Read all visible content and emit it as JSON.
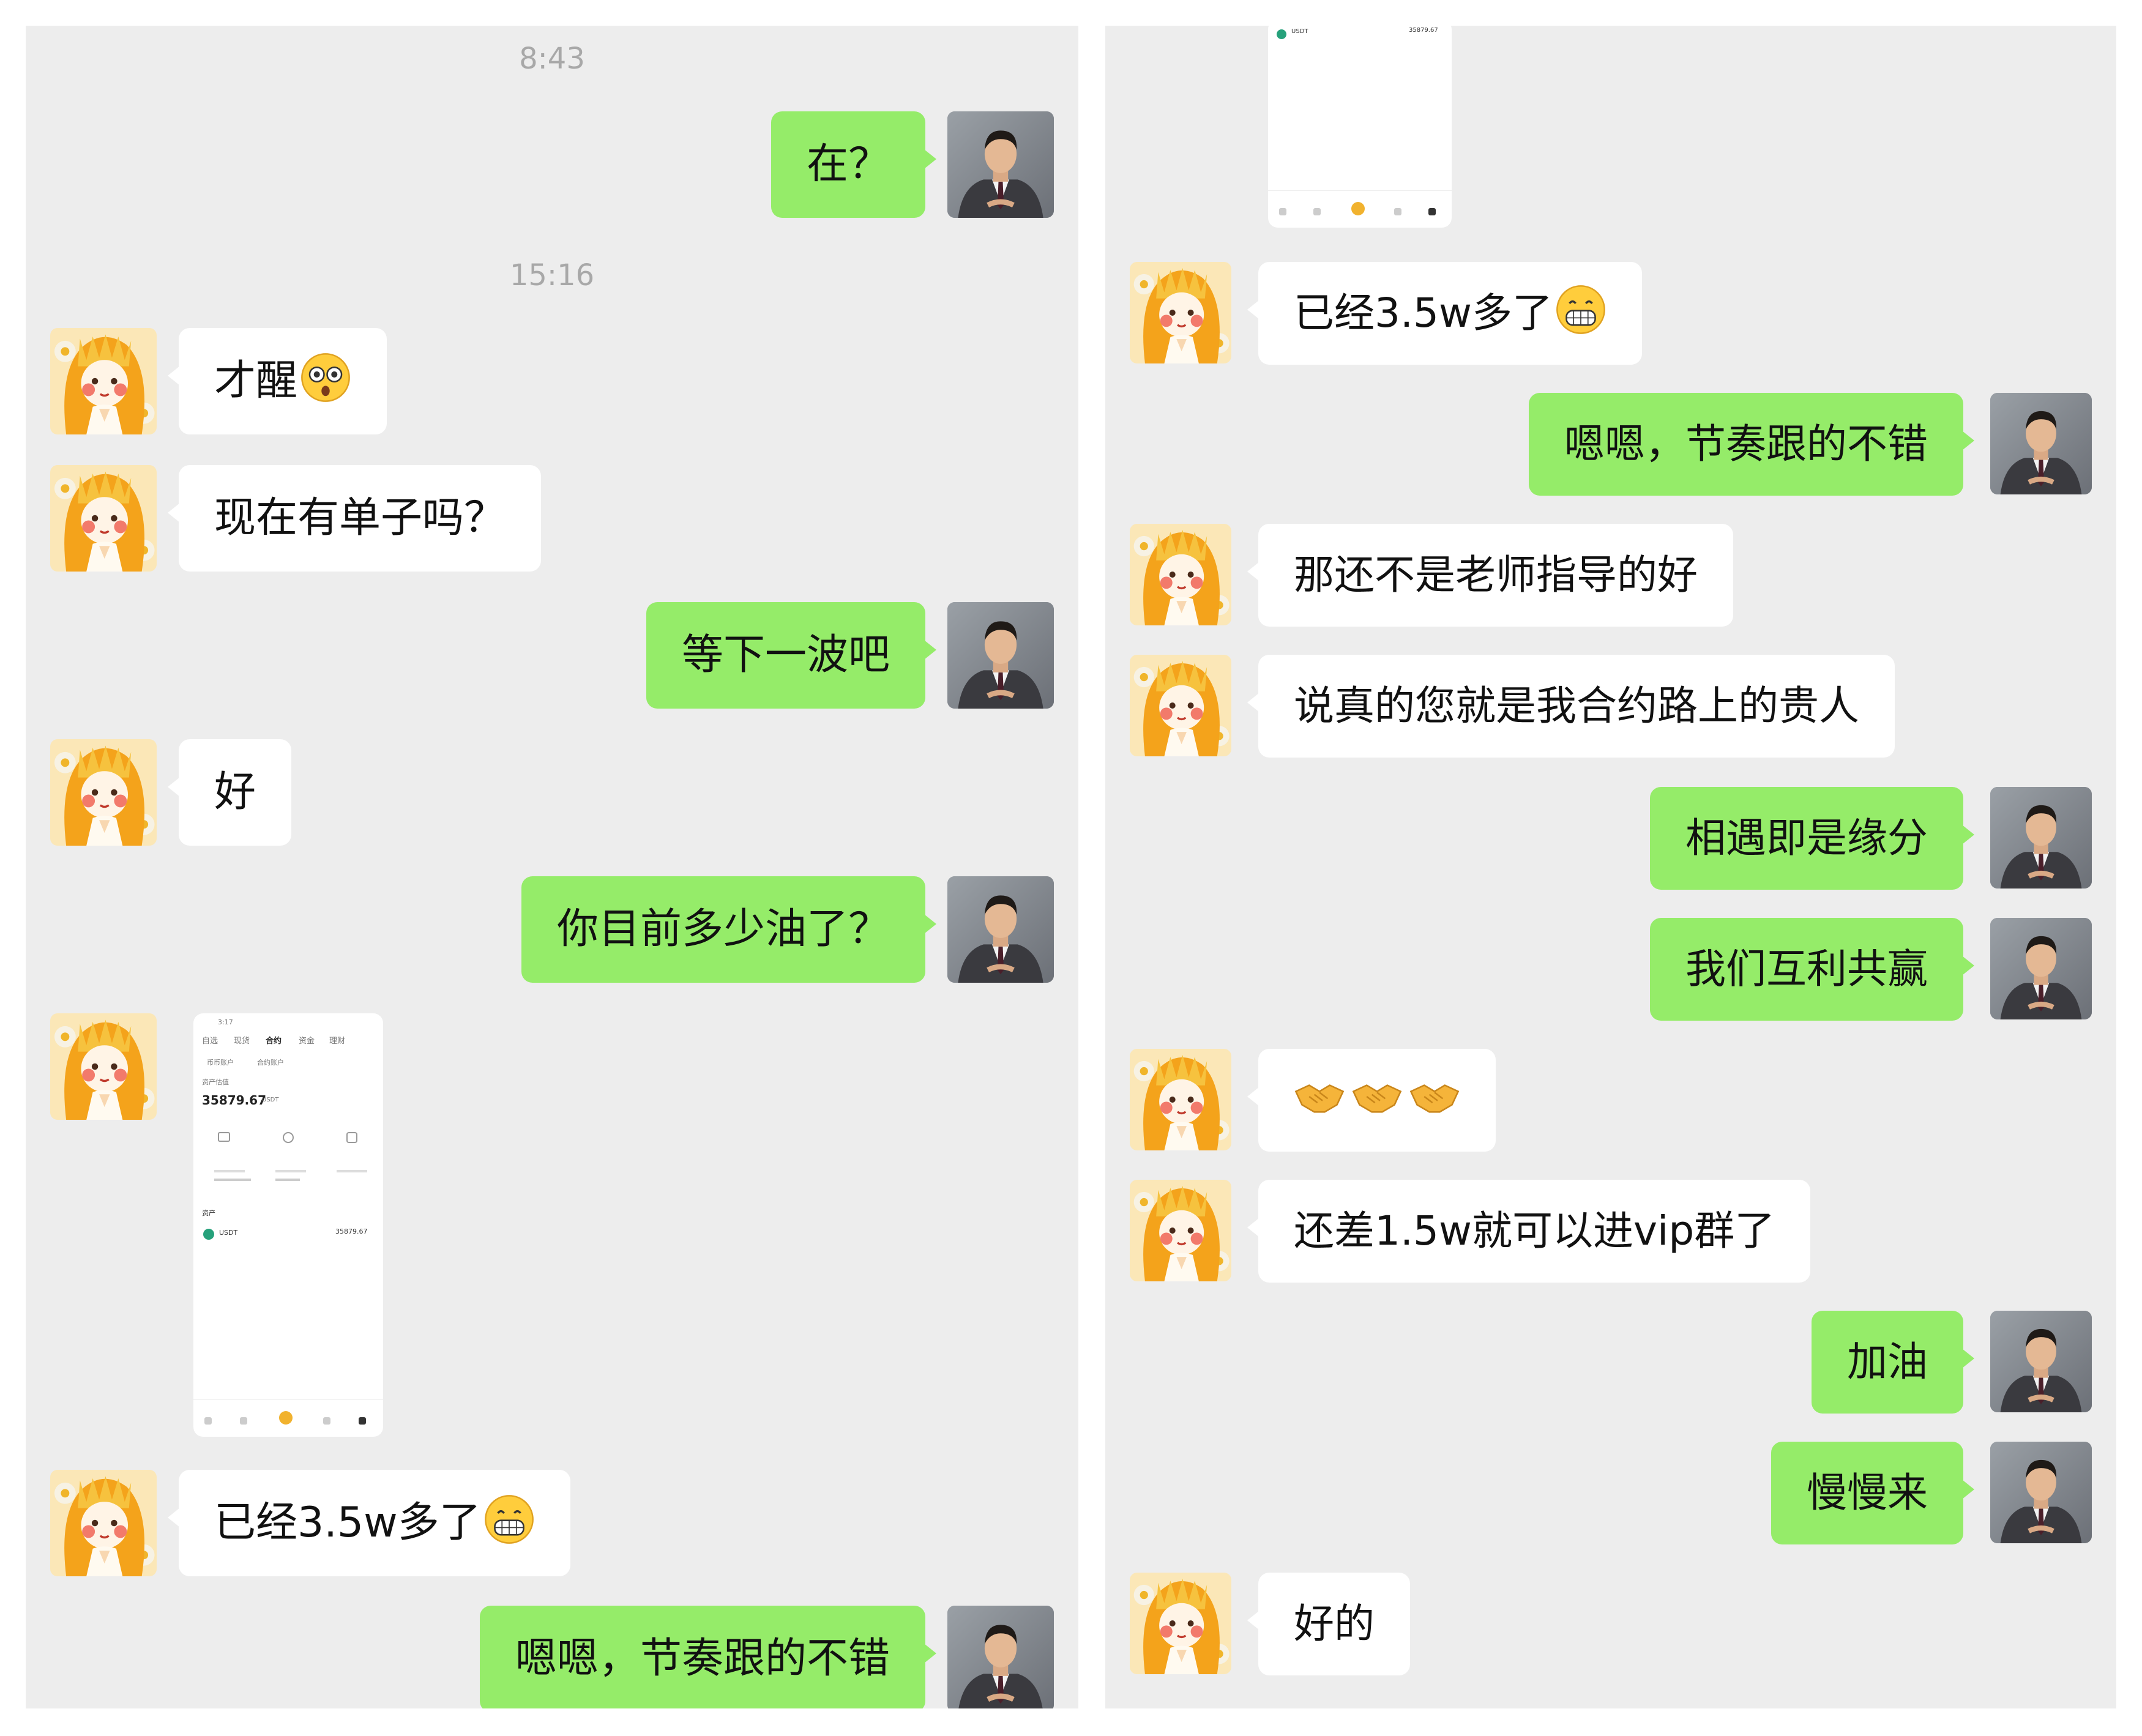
{
  "left": {
    "timestamps": [
      "8:43",
      "15:16"
    ],
    "messages": [
      {
        "side": "out",
        "text": "在？"
      },
      {
        "side": "in",
        "text": "才醒",
        "emoji": "dizzy-face-emoji"
      },
      {
        "side": "in",
        "text": "现在有单子吗？"
      },
      {
        "side": "out",
        "text": "等下一波吧"
      },
      {
        "side": "in",
        "text": "好"
      },
      {
        "side": "out",
        "text": "你目前多少油了？"
      },
      {
        "side": "in",
        "type": "image"
      },
      {
        "side": "in",
        "text": "已经3.5w多了",
        "emoji": "grinning-face-emoji"
      },
      {
        "side": "out",
        "text": "嗯嗯，节奏跟的不错"
      }
    ],
    "screenshot": {
      "tabs": [
        "自选",
        "现货",
        "合约",
        "资金",
        "理财"
      ],
      "subtabs": [
        "币币账户",
        "合约账户"
      ],
      "balance_label": "资产估值",
      "balance": "35879.67",
      "balance_unit": "USDT",
      "asset_header": "资产",
      "coin": "USDT",
      "coin_amount": "35879.67",
      "time": "3:17"
    }
  },
  "right": {
    "messages": [
      {
        "side": "in",
        "text": "已经3.5w多了",
        "emoji": "grinning-face-emoji"
      },
      {
        "side": "out",
        "text": "嗯嗯，节奏跟的不错"
      },
      {
        "side": "in",
        "text": "那还不是老师指导的好"
      },
      {
        "side": "in",
        "text": "说真的您就是我合约路上的贵人"
      },
      {
        "side": "out",
        "text": "相遇即是缘分"
      },
      {
        "side": "out",
        "text": "我们互利共赢"
      },
      {
        "side": "in",
        "text": "",
        "emoji": "handshake-emoji x3"
      },
      {
        "side": "in",
        "text": "还差1.5w就可以进vip群了"
      },
      {
        "side": "out",
        "text": "加油"
      },
      {
        "side": "out",
        "text": "慢慢来"
      },
      {
        "side": "in",
        "text": "好的"
      }
    ],
    "screenshot": {
      "coin": "USDT",
      "coin_amount": "35879.67"
    }
  },
  "colors": {
    "chat_bg": "#ededed",
    "bubble_out": "#95ec69",
    "bubble_in": "#ffffff",
    "timestamp": "#a8a8a8"
  }
}
